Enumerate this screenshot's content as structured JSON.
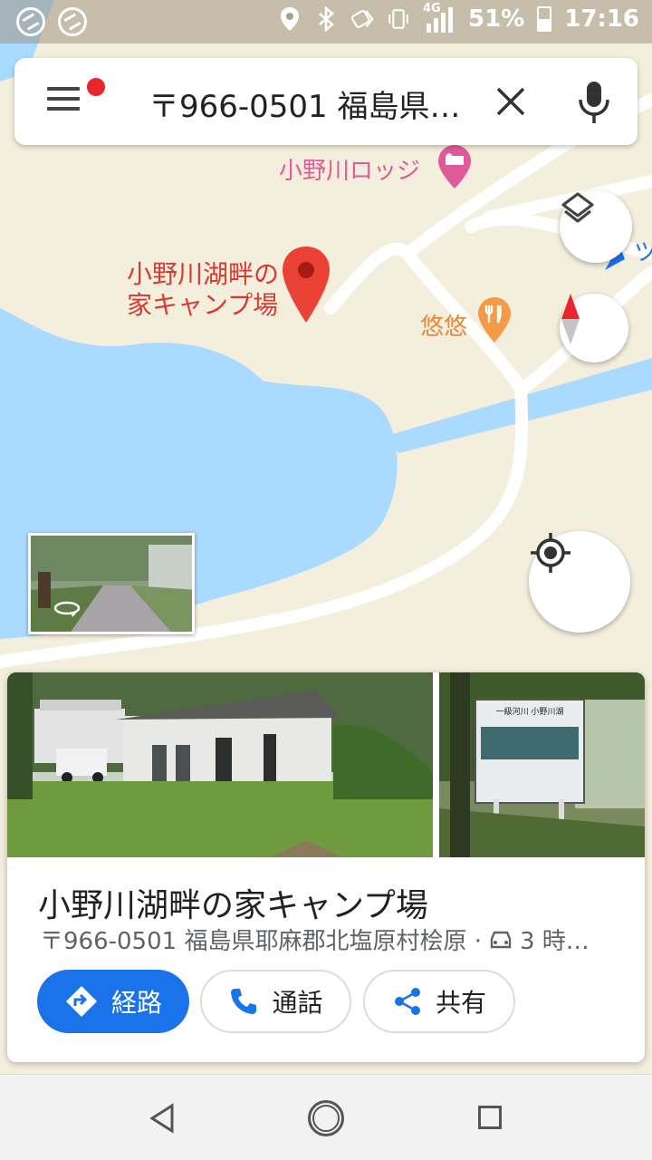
{
  "status_bar": {
    "network": "4G",
    "battery": "51%",
    "time": "17:16",
    "icons": [
      "app-icon",
      "app-icon",
      "location-icon",
      "bluetooth-icon",
      "nfc-icon",
      "vibrate-icon",
      "signal-icon",
      "battery-icon"
    ]
  },
  "search": {
    "query": "〒966-0501 福島県…",
    "menu_icon": "hamburger-icon",
    "clear_icon": "close-icon",
    "voice_icon": "mic-icon"
  },
  "map": {
    "labels": {
      "lodge": "小野川ロッジ",
      "cafe": "悠悠",
      "pin": "小野川湖畔の家キャンプ場",
      "edge": "ツ"
    },
    "colors": {
      "land": "#f4eedd",
      "water": "#aadaff",
      "road": "#ffffff",
      "pin": "#ea4335"
    }
  },
  "place": {
    "name": "小野川湖畔の家キャンプ場",
    "address": "〒966-0501 福島県耶麻郡北塩原村桧原 ·",
    "drive_time": "3 時…",
    "photo2_sign": "一級河川 小野川湖",
    "actions": {
      "route": "経路",
      "call": "通話",
      "share": "共有"
    }
  },
  "accent_color": "#1a73e8"
}
